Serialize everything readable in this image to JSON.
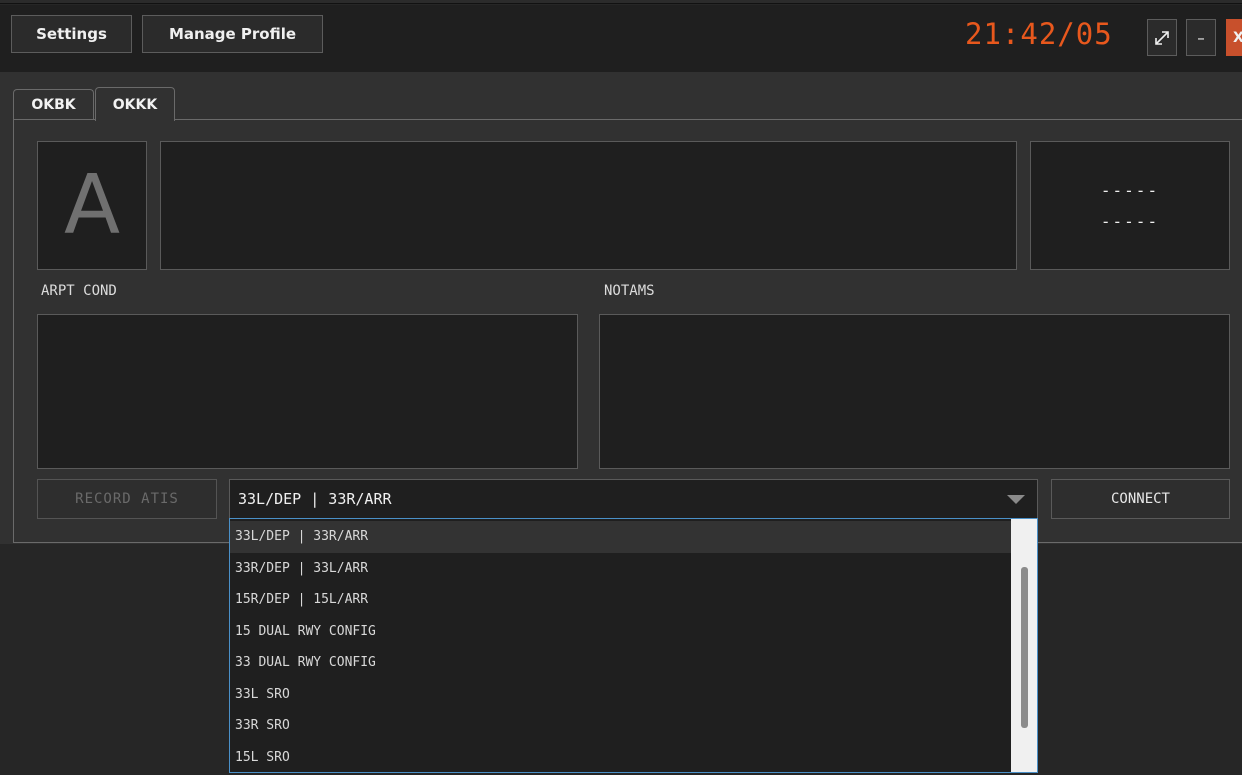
{
  "toolbar": {
    "settings_label": "Settings",
    "manage_profile_label": "Manage Profile",
    "clock": "21:42/05",
    "clock_color": "#e8581d",
    "maximize_icon": "↗↙",
    "minimize_label": "–",
    "close_label": "X",
    "close_color": "#c8502c"
  },
  "tabs": [
    {
      "label": "OKBK",
      "active": false
    },
    {
      "label": "OKKK",
      "active": true
    }
  ],
  "atis": {
    "letter": "A",
    "text": "",
    "info_line1": "-----",
    "info_line2": "-----"
  },
  "sections": {
    "arpt_cond_label": "ARPT COND",
    "arpt_cond_text": "",
    "notams_label": "NOTAMS",
    "notams_text": ""
  },
  "controls": {
    "record_label": "RECORD ATIS",
    "connect_label": "CONNECT",
    "runway_config_selected": "33L/DEP | 33R/ARR",
    "runway_config_options": [
      "33L/DEP | 33R/ARR",
      "33R/DEP | 33L/ARR",
      "15R/DEP | 15L/ARR",
      "15 DUAL RWY CONFIG",
      "33 DUAL RWY CONFIG",
      "33L SRO",
      "33R SRO",
      "15L SRO"
    ],
    "hovered_option_index": 0
  }
}
